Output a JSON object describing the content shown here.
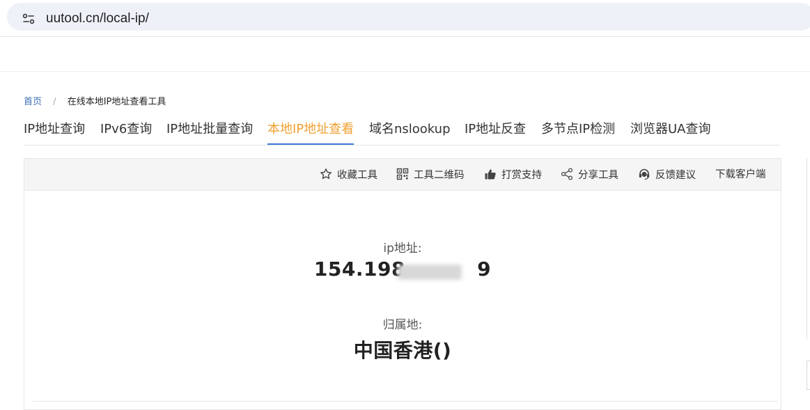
{
  "browser": {
    "url": "uutool.cn/local-ip/",
    "site_info_icon": "tune-icon"
  },
  "breadcrumb": {
    "home": "首页",
    "separator": "/",
    "current": "在线本地IP地址查看工具"
  },
  "tabs": [
    {
      "label": "IP地址查询"
    },
    {
      "label": "IPv6查询"
    },
    {
      "label": "IP地址批量查询"
    },
    {
      "label": "本地IP地址查看",
      "active": true
    },
    {
      "label": "域名nslookup"
    },
    {
      "label": "IP地址反查"
    },
    {
      "label": "多节点IP检测"
    },
    {
      "label": "浏览器UA查询"
    }
  ],
  "toolbar": {
    "favorite": "收藏工具",
    "qrcode": "工具二维码",
    "support": "打赏支持",
    "share": "分享工具",
    "feedback": "反馈建议",
    "download": "下载客户端"
  },
  "result": {
    "ip_label": "ip地址:",
    "ip_value": "154.198.",
    "ip_tail": "9",
    "location_label": "归属地:",
    "location_value": "中国香港()"
  },
  "colors": {
    "active_tab": "#f0a030",
    "tab_underline": "#3a78d8",
    "link": "#3a6fb0",
    "url_bar": "#eef1f8"
  }
}
